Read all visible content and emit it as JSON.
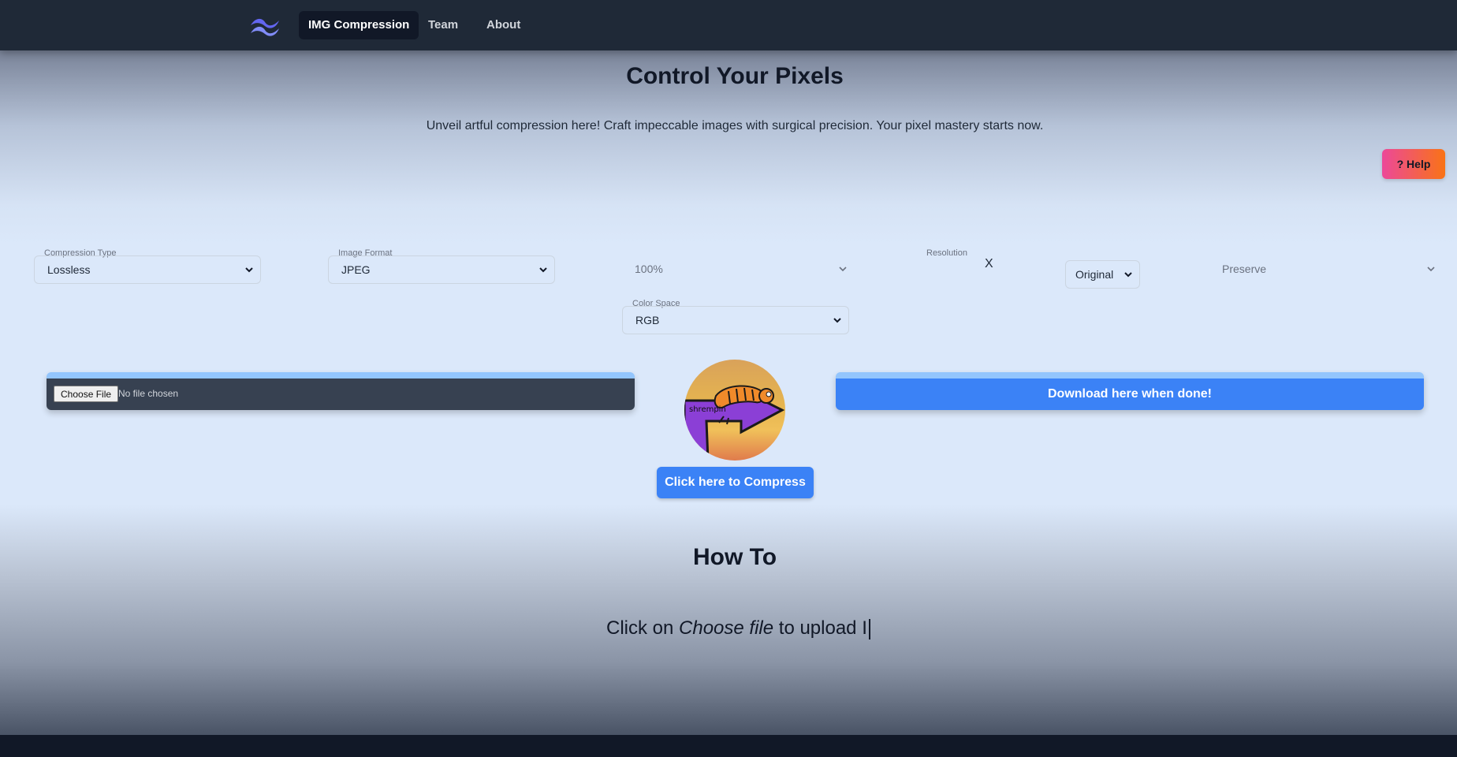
{
  "nav": {
    "logo_icon": "tailwind-waves-icon",
    "items": [
      {
        "label": "IMG Compression",
        "active": true
      },
      {
        "label": "Team",
        "active": false
      },
      {
        "label": "About",
        "active": false
      }
    ]
  },
  "hero": {
    "title": "Control Your Pixels",
    "subtitle": "Unveil artful compression here! Craft impeccable images with surgical precision. Your pixel mastery starts now."
  },
  "help": {
    "label": "? Help"
  },
  "settings": {
    "compression_type": {
      "label": "Compression Type",
      "value": "Lossless"
    },
    "image_format": {
      "label": "Image Format",
      "value": "JPEG"
    },
    "quality": {
      "value": "100%"
    },
    "resolution": {
      "label": "Resolution",
      "separator": "X",
      "preset": "Original"
    },
    "metadata": {
      "value": "Preserve"
    },
    "color_space": {
      "label": "Color Space",
      "value": "RGB"
    }
  },
  "upload": {
    "button_label": "Choose File",
    "status": "No file chosen"
  },
  "mascot": {
    "caption": "shrempin"
  },
  "download": {
    "label": "Download here when done!"
  },
  "compress": {
    "label": "Click here to Compress"
  },
  "howto": {
    "title": "How To",
    "text_before": "Click on ",
    "text_emphasis": "Choose file",
    "text_after": " to upload I"
  },
  "colors": {
    "accent": "#3b82f6",
    "nav_bg": "#1f2937",
    "help_gradient_start": "#ec4899",
    "help_gradient_end": "#f97316"
  }
}
